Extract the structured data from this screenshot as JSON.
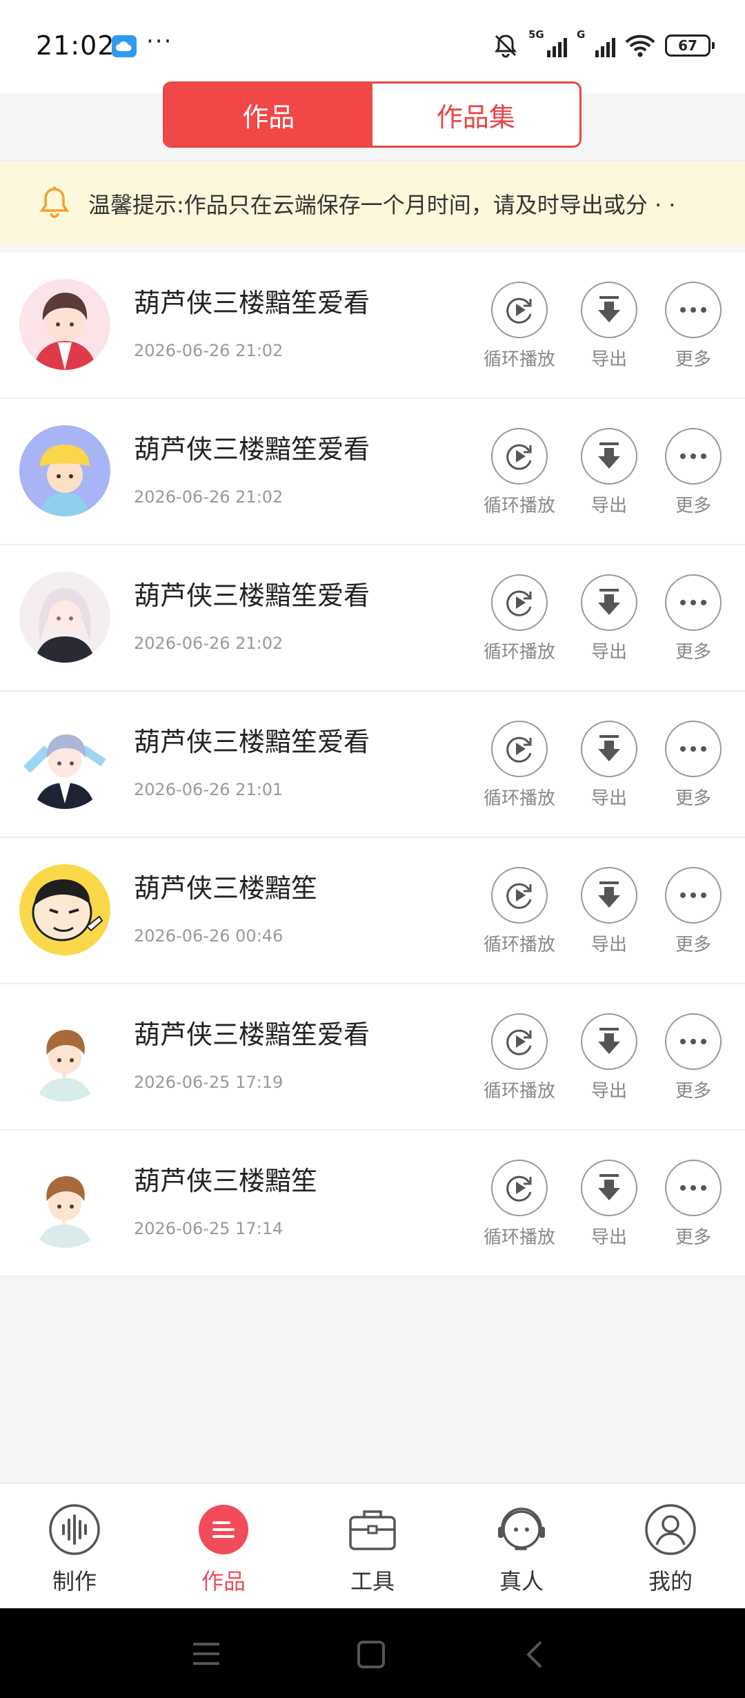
{
  "status_bar": {
    "time": "21:02",
    "more": "···",
    "network_5g": "5G",
    "network_g": "G",
    "battery": "67"
  },
  "tabs": {
    "works": "作品",
    "collections": "作品集"
  },
  "notice": {
    "text": "温馨提示:作品只在云端保存一个月时间，请及时导出或分 · ·"
  },
  "actions": {
    "loop": "循环播放",
    "export": "导出",
    "more": "更多"
  },
  "items": [
    {
      "title": "葫芦侠三楼黯笙爱看",
      "date": "2026-06-26 21:02",
      "avatar": "avatar-boy-red-jacket"
    },
    {
      "title": "葫芦侠三楼黯笙爱看",
      "date": "2026-06-26 21:02",
      "avatar": "avatar-child-yellow-hat"
    },
    {
      "title": "葫芦侠三楼黯笙爱看",
      "date": "2026-06-26 21:02",
      "avatar": "avatar-girl-white-hair"
    },
    {
      "title": "葫芦侠三楼黯笙爱看",
      "date": "2026-06-26 21:01",
      "avatar": "avatar-boy-silver-hair"
    },
    {
      "title": "葫芦侠三楼黯笙",
      "date": "2026-06-26 00:46",
      "avatar": "avatar-cartoon-face"
    },
    {
      "title": "葫芦侠三楼黯笙爱看",
      "date": "2026-06-25 17:19",
      "avatar": "avatar-boy-brown-hair"
    },
    {
      "title": "葫芦侠三楼黯笙",
      "date": "2026-06-25 17:14",
      "avatar": "avatar-boy-brown-hair"
    }
  ],
  "bottom_nav": [
    {
      "label": "制作",
      "icon": "waveform-icon"
    },
    {
      "label": "作品",
      "icon": "list-icon",
      "active": true
    },
    {
      "label": "工具",
      "icon": "toolbox-icon"
    },
    {
      "label": "真人",
      "icon": "headset-icon"
    },
    {
      "label": "我的",
      "icon": "user-icon"
    }
  ],
  "colors": {
    "accent": "#f24747",
    "notice_bg": "#fdf8dc",
    "active_nav": "#f24b5a"
  }
}
